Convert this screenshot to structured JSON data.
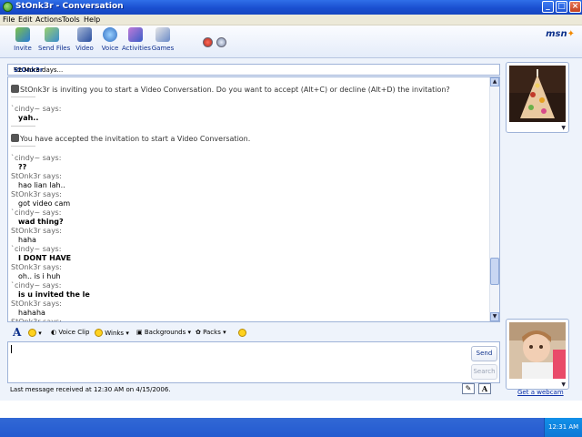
{
  "window": {
    "title": "StOnk3r - Conversation"
  },
  "menu": [
    "File",
    "Edit",
    "Actions",
    "Tools",
    "Help"
  ],
  "toolbar": {
    "buttons": [
      "Invite",
      "Send Files",
      "Video",
      "Voice",
      "Activities",
      "Games"
    ]
  },
  "to_bar": {
    "prefix": "To:",
    "contact": "StOnk3r",
    "suffix": "- 2 More days..."
  },
  "chat": {
    "invite_notice": "StOnk3r is inviting you to start a Video Conversation. Do you want to accept (Alt+C) or decline (Alt+D) the invitation?",
    "accepted_notice": "You have accepted the invitation to start a Video Conversation.",
    "first_message": {
      "sender": "`cindy~ says:",
      "text": "yah.."
    },
    "messages": [
      {
        "sender": "`cindy~ says:",
        "text": "??",
        "bold": true
      },
      {
        "sender": "StOnk3r says:",
        "text": "hao lian lah..",
        "bold": false
      },
      {
        "sender": "StOnk3r says:",
        "text": "got video cam",
        "bold": false
      },
      {
        "sender": "`cindy~ says:",
        "text": "wad thing?",
        "bold": true
      },
      {
        "sender": "StOnk3r says:",
        "text": "haha",
        "bold": false
      },
      {
        "sender": "`cindy~ says:",
        "text": "I DONT HAVE",
        "bold": true
      },
      {
        "sender": "StOnk3r says:",
        "text": "oh.. is i huh",
        "bold": false
      },
      {
        "sender": "`cindy~ says:",
        "text": "is u invited the le",
        "bold": true
      },
      {
        "sender": "StOnk3r says:",
        "text": "hahaha",
        "bold": false
      },
      {
        "sender": "StOnk3r says:",
        "text": "",
        "bold": false
      }
    ]
  },
  "format_bar": {
    "voice_clip": "Voice Clip",
    "winks": "Winks",
    "backgrounds": "Backgrounds",
    "packs": "Packs"
  },
  "input": {
    "send_label": "Send",
    "search_label": "Search"
  },
  "status": {
    "text": "Last message received at 12:30 AM on 4/15/2006."
  },
  "sidebar": {
    "webcam_link": "Get a webcam"
  },
  "taskbar": {
    "clock": "12:31 AM"
  }
}
